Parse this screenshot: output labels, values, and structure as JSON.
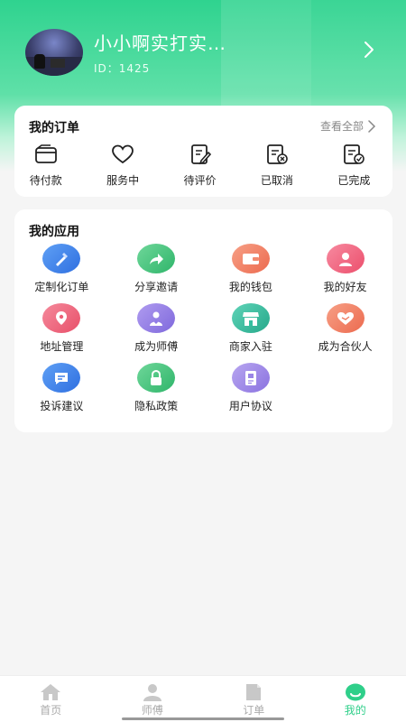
{
  "profile": {
    "username": "小小啊实打实…",
    "user_id": "ID：1425"
  },
  "orders": {
    "title": "我的订单",
    "view_all": "查看全部",
    "items": [
      {
        "label": "待付款",
        "icon": "wallet-icon"
      },
      {
        "label": "服务中",
        "icon": "heart-icon"
      },
      {
        "label": "待评价",
        "icon": "edit-note-icon"
      },
      {
        "label": "已取消",
        "icon": "cancel-document-icon"
      },
      {
        "label": "已完成",
        "icon": "done-document-icon"
      }
    ]
  },
  "apps": {
    "title": "我的应用",
    "items": [
      {
        "label": "定制化订单",
        "icon": "custom-order-icon",
        "color": "#3d7fe8"
      },
      {
        "label": "分享邀请",
        "icon": "share-icon",
        "color": "#3fc27a"
      },
      {
        "label": "我的钱包",
        "icon": "wallet-icon",
        "color": "#f07a60"
      },
      {
        "label": "我的好友",
        "icon": "friend-icon",
        "color": "#f0607a"
      },
      {
        "label": "地址管理",
        "icon": "location-icon",
        "color": "#ef5f76"
      },
      {
        "label": "成为师傅",
        "icon": "master-icon",
        "color": "#8f7ae6"
      },
      {
        "label": "商家入驻",
        "icon": "store-icon",
        "color": "#35bfa0"
      },
      {
        "label": "成为合伙人",
        "icon": "handshake-icon",
        "color": "#f07a60"
      },
      {
        "label": "投诉建议",
        "icon": "message-icon",
        "color": "#3d7fe8"
      },
      {
        "label": "隐私政策",
        "icon": "lock-icon",
        "color": "#3fc27a"
      },
      {
        "label": "用户协议",
        "icon": "document-icon",
        "color": "#9a85e6"
      }
    ]
  },
  "tabbar": {
    "items": [
      {
        "label": "首页",
        "icon": "home-icon"
      },
      {
        "label": "师傅",
        "icon": "master-icon"
      },
      {
        "label": "订单",
        "icon": "order-icon"
      },
      {
        "label": "我的",
        "icon": "profile-icon"
      }
    ],
    "active_index": 3
  },
  "colors": {
    "accent": "#2fcf8a",
    "header_gradient_top": "#2fd38f"
  }
}
